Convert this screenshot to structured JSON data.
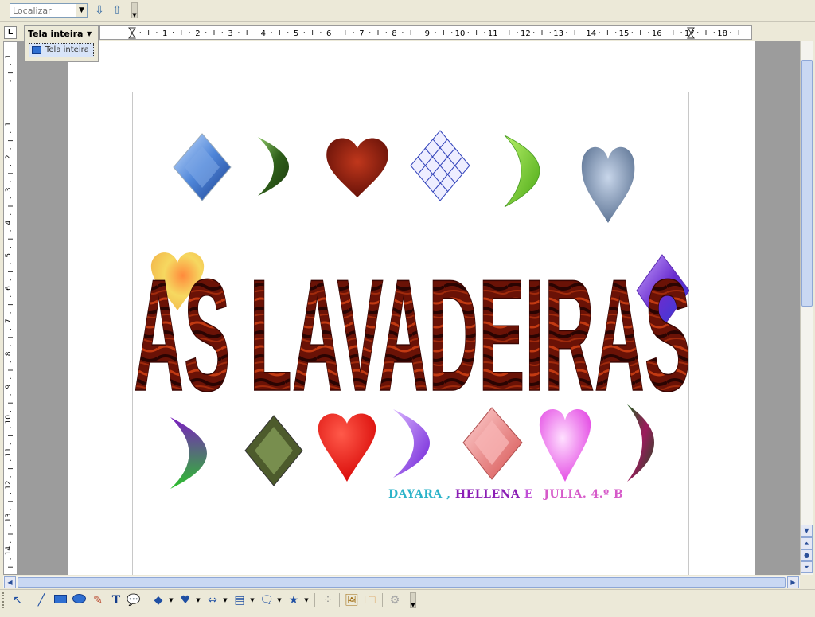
{
  "find_toolbar": {
    "search_placeholder": "Localizar",
    "icons": [
      "find-next-icon",
      "find-previous-icon"
    ]
  },
  "zoom": {
    "selected": "Tela inteira",
    "options": [
      "Tela inteira"
    ]
  },
  "rulers": {
    "horizontal_numbers": [
      "1",
      "2",
      "3",
      "4",
      "5",
      "6",
      "7",
      "8",
      "9",
      "10",
      "11",
      "12",
      "13",
      "14",
      "15",
      "16",
      "17",
      "18"
    ],
    "vertical_numbers": [
      "1",
      "1",
      "2",
      "3",
      "4",
      "5",
      "6",
      "7",
      "8",
      "9",
      "10",
      "11",
      "12",
      "13",
      "14"
    ]
  },
  "document": {
    "wordart_title": "AS LAVADEIRAS",
    "credits": {
      "part1": "DAYARA ,",
      "part2": "HELLENA",
      "part3": "E",
      "part4": "JULIA. 4.º B"
    },
    "credit_colors": [
      "#2bb3c9",
      "#8b1fb5",
      "#c04fd6",
      "#d65ac9"
    ],
    "shapes": [
      {
        "kind": "diamond",
        "fill": "#4f86d9"
      },
      {
        "kind": "moon",
        "fill": "#3a6b1f"
      },
      {
        "kind": "heart",
        "fill": "#8a1a0a"
      },
      {
        "kind": "diamond",
        "fill": "#2c3bc4"
      },
      {
        "kind": "moon",
        "fill": "#6bcc1e"
      },
      {
        "kind": "heart",
        "fill": "#7d94b3"
      },
      {
        "kind": "heart",
        "fill": "#f1c45a"
      },
      {
        "kind": "diamond",
        "fill": "#6a2dcf"
      },
      {
        "kind": "moon",
        "fill": "#4a9b25"
      },
      {
        "kind": "diamond",
        "fill": "#4d5b2c"
      },
      {
        "kind": "heart",
        "fill": "#e0100d"
      },
      {
        "kind": "moon",
        "fill": "#7b2ad6"
      },
      {
        "kind": "diamond",
        "fill": "#e98d8d"
      },
      {
        "kind": "heart",
        "fill": "#e55de5"
      },
      {
        "kind": "moon",
        "fill": "#2c6b2a"
      }
    ]
  },
  "drawing_toolbar": {
    "tools": [
      "select-icon",
      "line-icon",
      "rectangle-icon",
      "ellipse-icon",
      "freeform-icon",
      "text-icon",
      "callout-icon",
      "basic-shapes-icon",
      "symbol-shapes-icon",
      "block-arrows-icon",
      "flowchart-icon",
      "callouts-icon",
      "stars-icon",
      "points-icon",
      "fontwork-gallery-icon",
      "from-file-icon",
      "extrusion-icon"
    ]
  }
}
